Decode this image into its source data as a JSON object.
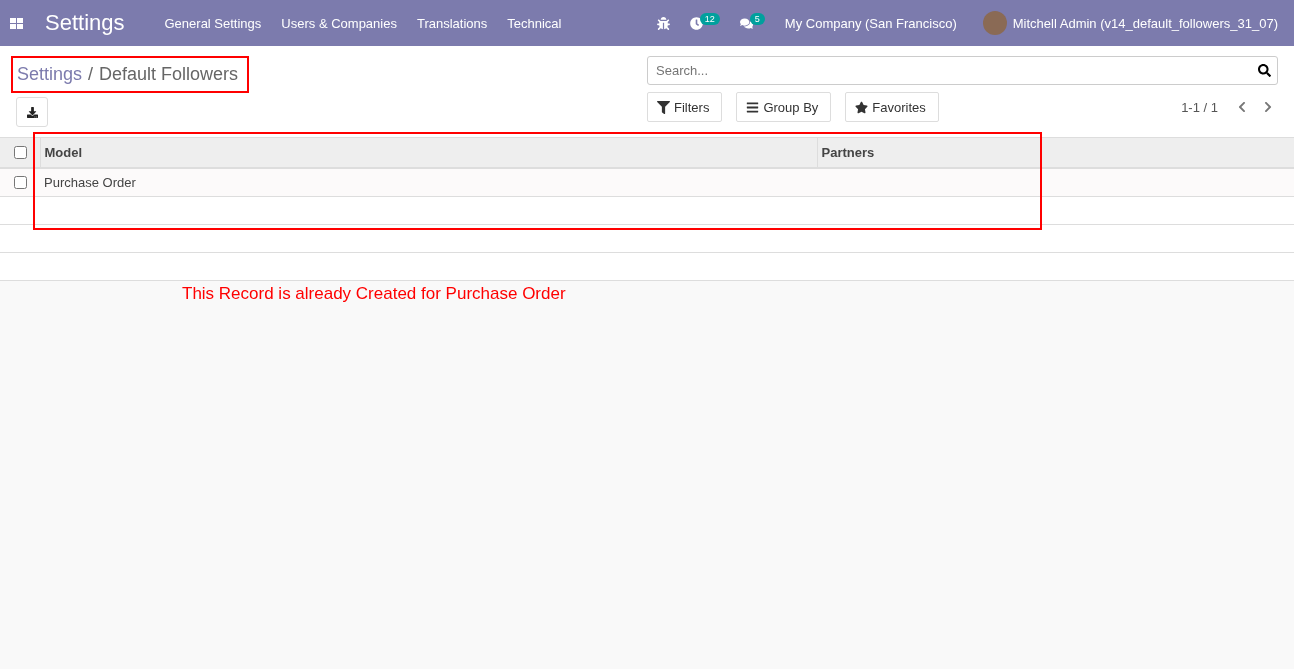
{
  "navbar": {
    "app_title": "Settings",
    "menu": [
      "General Settings",
      "Users & Companies",
      "Translations",
      "Technical"
    ],
    "activity_count": "12",
    "message_count": "5",
    "company": "My Company (San Francisco)",
    "user": "Mitchell Admin (v14_default_followers_31_07)"
  },
  "breadcrumb": {
    "parent": "Settings",
    "separator": "/",
    "current": "Default Followers"
  },
  "search": {
    "placeholder": "Search..."
  },
  "filters": [
    {
      "kind": "filter",
      "label": "Filters"
    },
    {
      "kind": "group",
      "label": "Group By"
    },
    {
      "kind": "favorite",
      "label": "Favorites"
    }
  ],
  "pager": "1-1 / 1",
  "table": {
    "select_all_checked": false,
    "columns": [
      "Model",
      "Partners"
    ],
    "rows": [
      {
        "checked": false,
        "cells": [
          "Purchase Order",
          ""
        ]
      }
    ]
  },
  "annotation": "This Record is already Created for Purchase Order"
}
